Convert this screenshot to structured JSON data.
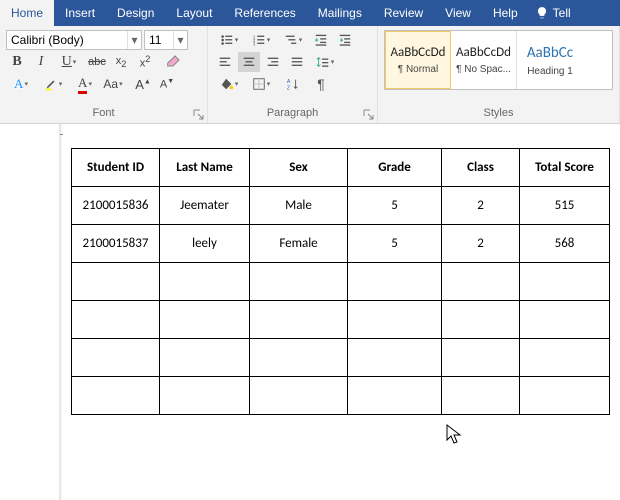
{
  "tabs": {
    "home": "Home",
    "insert": "Insert",
    "design": "Design",
    "layout": "Layout",
    "references": "References",
    "mailings": "Mailings",
    "review": "Review",
    "view": "View",
    "help": "Help",
    "tell": "Tell"
  },
  "font": {
    "name": "Calibri (Body)",
    "size": "11",
    "group_label": "Font"
  },
  "paragraph": {
    "group_label": "Paragraph"
  },
  "styles": {
    "group_label": "Styles",
    "preview_text": "AaBbCcDd",
    "preview_h1": "AaBbCc",
    "items": [
      {
        "name": "¶ Normal"
      },
      {
        "name": "¶ No Spac..."
      },
      {
        "name": "Heading 1"
      }
    ]
  },
  "table": {
    "headers": [
      "Student ID",
      "Last Name",
      "Sex",
      "Grade",
      "Class",
      "Total Score"
    ],
    "rows": [
      [
        "2100015836",
        "Jeemater",
        "Male",
        "5",
        "2",
        "515"
      ],
      [
        "2100015837",
        "leely",
        "Female",
        "5",
        "2",
        "568"
      ],
      [
        "",
        "",
        "",
        "",
        "",
        ""
      ],
      [
        "",
        "",
        "",
        "",
        "",
        ""
      ],
      [
        "",
        "",
        "",
        "",
        "",
        ""
      ],
      [
        "",
        "",
        "",
        "",
        "",
        ""
      ]
    ]
  }
}
